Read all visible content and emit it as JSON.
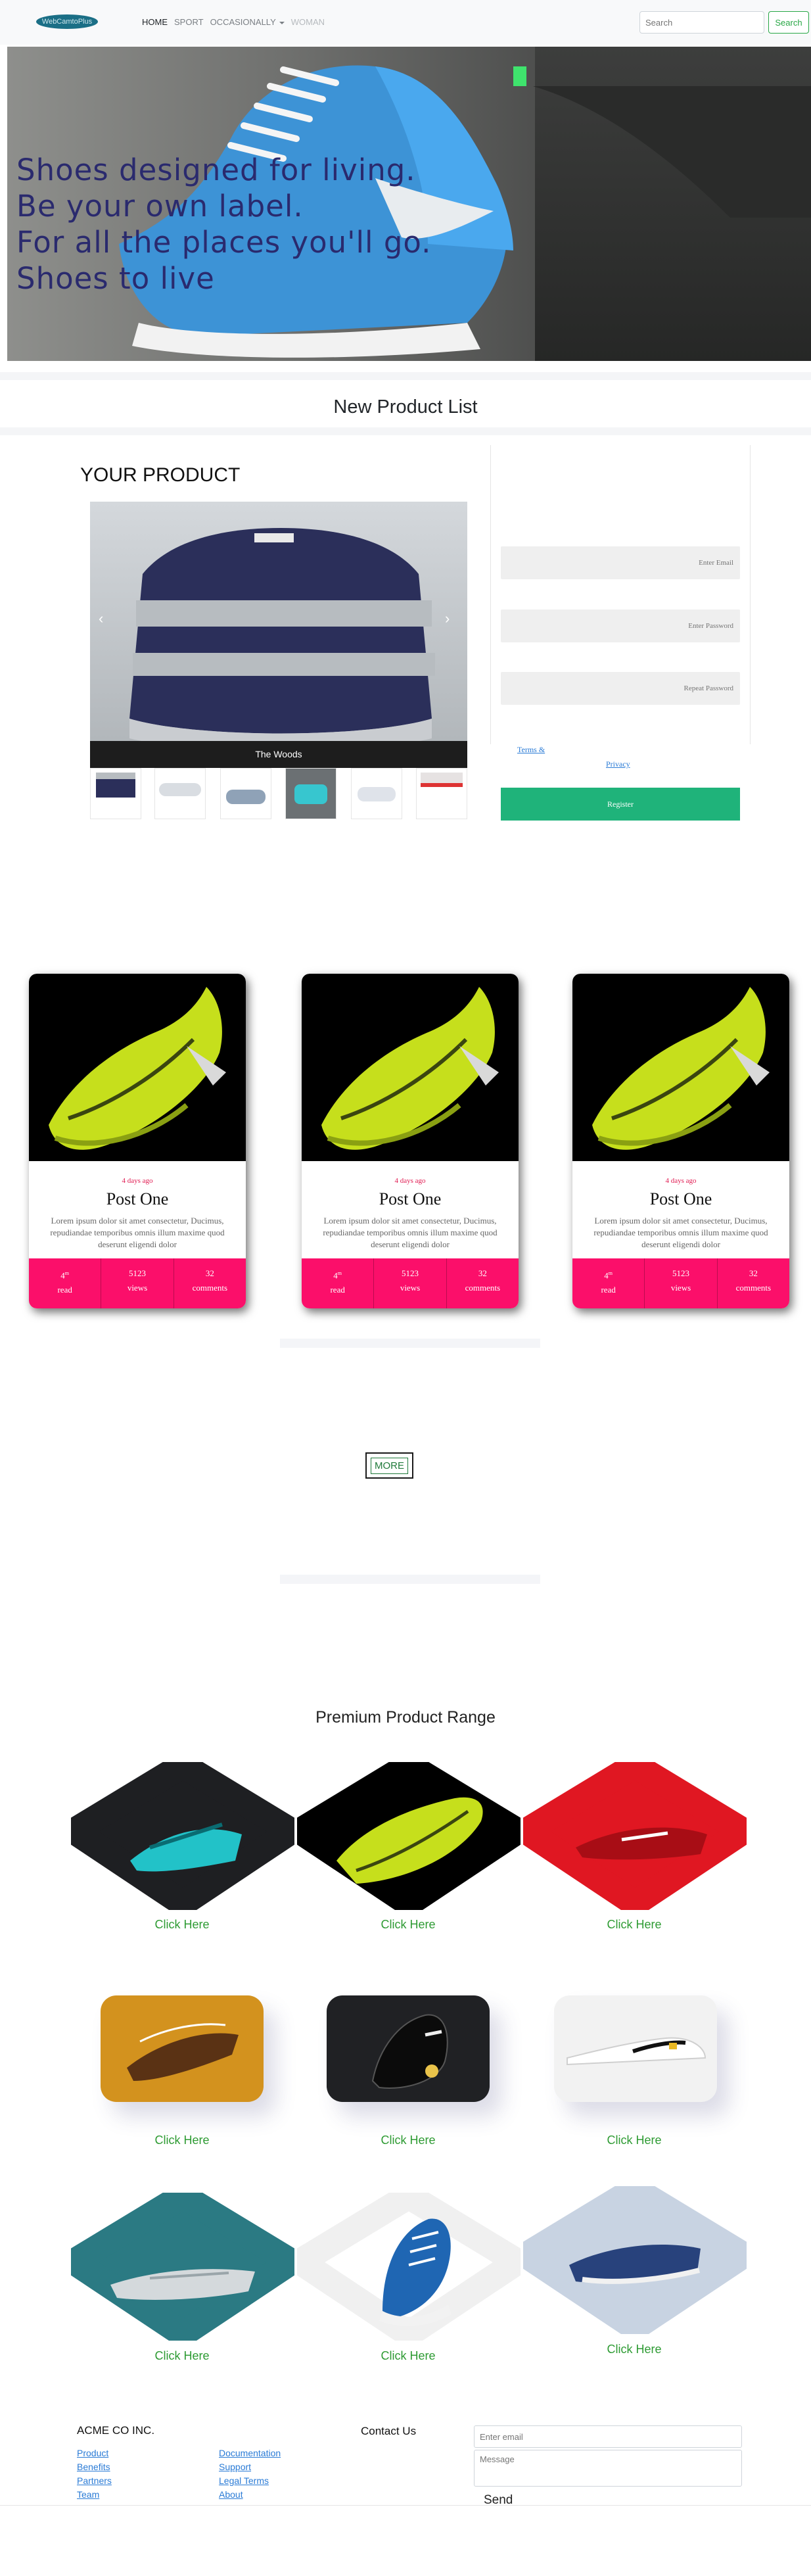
{
  "navbar": {
    "brand": "WebCamtoPlus",
    "links": [
      {
        "label": "HOME",
        "state": "active"
      },
      {
        "label": "SPORT",
        "state": "normal"
      },
      {
        "label": "OCCASIONALLY",
        "state": "dropdown"
      },
      {
        "label": "WOMAN",
        "state": "disabled"
      }
    ],
    "search_placeholder": "Search",
    "search_button": "Search"
  },
  "hero": {
    "lines": [
      "Shoes designed for living.",
      "Be your own label.",
      "For all the places you'll go.",
      "Shoes to live"
    ]
  },
  "new_product": {
    "title": "New Product List"
  },
  "product_carousel": {
    "heading": "YOUR PRODUCT",
    "caption": "The Woods",
    "prev_icon": "chevron-left-icon",
    "next_icon": "chevron-right-icon"
  },
  "register_form": {
    "email_placeholder": "Enter Email",
    "password_placeholder": "Enter Password",
    "repeat_placeholder": "Repeat Password",
    "terms_link": "Terms &",
    "privacy_link": "Privacy",
    "register_button": "Register"
  },
  "posts": [
    {
      "date": "4 days ago",
      "title": "Post One",
      "text": "Lorem ipsum dolor sit amet consectetur, Ducimus, repudiandae temporibus omnis illum maxime quod deserunt eligendi dolor",
      "stats": [
        {
          "value": "4",
          "sup": "m",
          "label": "read"
        },
        {
          "value": "5123",
          "sup": "",
          "label": "views"
        },
        {
          "value": "32",
          "sup": "",
          "label": "comments"
        }
      ]
    },
    {
      "date": "4 days ago",
      "title": "Post One",
      "text": "Lorem ipsum dolor sit amet consectetur, Ducimus, repudiandae temporibus omnis illum maxime quod deserunt eligendi dolor",
      "stats": [
        {
          "value": "4",
          "sup": "m",
          "label": "read"
        },
        {
          "value": "5123",
          "sup": "",
          "label": "views"
        },
        {
          "value": "32",
          "sup": "",
          "label": "comments"
        }
      ]
    },
    {
      "date": "4 days ago",
      "title": "Post One",
      "text": "Lorem ipsum dolor sit amet consectetur, Ducimus, repudiandae temporibus omnis illum maxime quod deserunt eligendi dolor",
      "stats": [
        {
          "value": "4",
          "sup": "m",
          "label": "read"
        },
        {
          "value": "5123",
          "sup": "",
          "label": "views"
        },
        {
          "value": "32",
          "sup": "",
          "label": "comments"
        }
      ]
    }
  ],
  "more_button": "MORE",
  "premium": {
    "title": "Premium Product Range",
    "link_label": "Click Here"
  },
  "footer": {
    "company": "ACME CO INC.",
    "links_col1": [
      "Product",
      "Benefits",
      "Partners",
      "Team"
    ],
    "links_col2": [
      "Documentation",
      "Support",
      "Legal Terms",
      "About"
    ],
    "contact_title": "Contact Us",
    "email_placeholder": "Enter email",
    "message_placeholder": "Message",
    "send_label": "Send"
  },
  "colors": {
    "accent_green": "#28a745",
    "stats_pink": "#fb0f6a",
    "register_green": "#1fb37a",
    "hero_text": "#2a2a6e"
  }
}
